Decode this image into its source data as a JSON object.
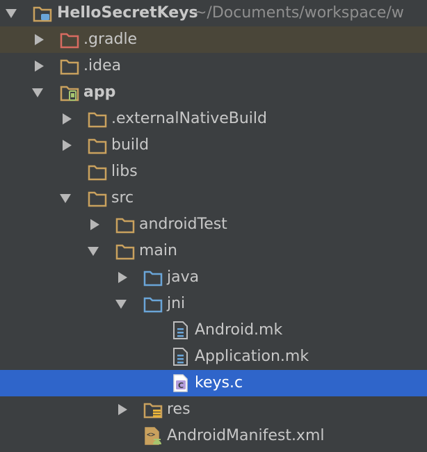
{
  "tree": {
    "root_name": "HelloSecretKeys",
    "root_path": " ~/Documents/workspace/w",
    "items": [
      {
        "label": ".gradle"
      },
      {
        "label": ".idea"
      },
      {
        "label": "app"
      },
      {
        "label": ".externalNativeBuild"
      },
      {
        "label": "build"
      },
      {
        "label": "libs"
      },
      {
        "label": "src"
      },
      {
        "label": "androidTest"
      },
      {
        "label": "main"
      },
      {
        "label": "java"
      },
      {
        "label": "jni"
      },
      {
        "label": "Android.mk"
      },
      {
        "label": "Application.mk"
      },
      {
        "label": "keys.c"
      },
      {
        "label": "res"
      },
      {
        "label": "AndroidManifest.xml"
      }
    ]
  },
  "colors": {
    "background": "#3c3f41",
    "selection": "#2f65ca",
    "folder": "#c9a15e",
    "gradle_folder": "#d86b61",
    "source_folder": "#6aa5d8"
  }
}
